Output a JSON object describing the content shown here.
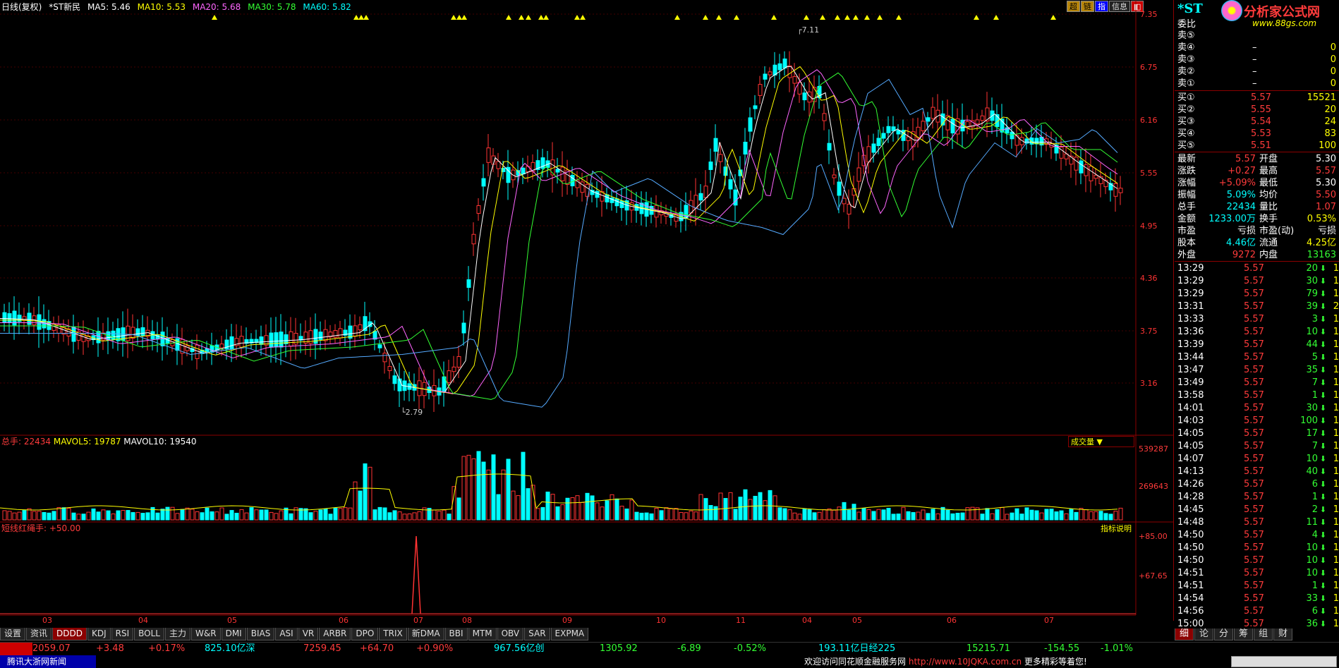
{
  "header": {
    "period": "日线(复权)",
    "stock": "*ST新民",
    "ma5": "MA5: 5.46",
    "ma10": "MA10: 5.53",
    "ma20": "MA20: 5.68",
    "ma30": "MA30: 5.78",
    "ma60": "MA60: 5.82"
  },
  "top_buttons": [
    "超",
    "链",
    "指",
    "信息"
  ],
  "price_ticks": [
    "7.35",
    "6.75",
    "6.16",
    "5.55",
    "4.95",
    "4.36",
    "3.75",
    "3.16"
  ],
  "annot_high": "7.11",
  "annot_low": "2.79",
  "vol_header": {
    "total": "总手: 22434",
    "mavol5": "MAVOL5: 19787",
    "mavol10": "MAVOL10: 19540"
  },
  "vol_ticks": [
    "539287",
    "269643"
  ],
  "vol_select": "成交量 ▼",
  "ind_header": "短线红绳手: +50.00",
  "ind_btn": "指标说明",
  "ind_ticks": [
    "+85.00",
    "+67.65"
  ],
  "x_axis": [
    "03",
    "04",
    "05",
    "06",
    "07",
    "08",
    "09",
    "10",
    "11",
    "04",
    "05",
    "06",
    "07"
  ],
  "tabs": [
    "设置",
    "资讯",
    "DDDD",
    "KDJ",
    "RSI",
    "BOLL",
    "主力",
    "W&R",
    "DMI",
    "BIAS",
    "ASI",
    "VR",
    "ARBR",
    "DPO",
    "TRIX",
    "新DMA",
    "BBI",
    "MTM",
    "OBV",
    "SAR",
    "EXPMA"
  ],
  "status": {
    "sh_idx": "2059.07",
    "sh_chg": "+3.48",
    "sh_pct": "+0.17%",
    "sh_amt": "825.10亿深",
    "sz_idx": "7259.45",
    "sz_chg": "+64.70",
    "sz_pct": "+0.90%",
    "sz_amt": "967.56亿创",
    "cy_idx": "1305.92",
    "cy_chg": "-6.89",
    "cy_pct": "-0.52%",
    "cy_amt": "193.11亿日经225",
    "nk_idx": "15215.71",
    "nk_chg": "-154.55",
    "nk_pct": "-1.01%"
  },
  "bottom": {
    "news": "腾讯大浙网新闻",
    "welcome": "欢迎访问同花顺金融服务网",
    "url": "http://www.10JQKA.com.cn",
    "more": "更多精彩等着您!"
  },
  "logo": {
    "name": "分析家公式网",
    "url": "www.88gs.com"
  },
  "right": {
    "code": "*ST",
    "weibi": "委比",
    "sells": [
      {
        "l": "卖⑤",
        "p": "",
        "v": ""
      },
      {
        "l": "卖④",
        "p": "–",
        "v": "0"
      },
      {
        "l": "卖③",
        "p": "–",
        "v": "0"
      },
      {
        "l": "卖②",
        "p": "–",
        "v": "0"
      },
      {
        "l": "卖①",
        "p": "–",
        "v": "0"
      }
    ],
    "buys": [
      {
        "l": "买①",
        "p": "5.57",
        "v": "15521"
      },
      {
        "l": "买②",
        "p": "5.55",
        "v": "20"
      },
      {
        "l": "买③",
        "p": "5.54",
        "v": "24"
      },
      {
        "l": "买④",
        "p": "5.53",
        "v": "83"
      },
      {
        "l": "买⑤",
        "p": "5.51",
        "v": "100"
      }
    ],
    "stats": [
      {
        "a": "最新",
        "av": "5.57",
        "b": "开盘",
        "bv": "5.30"
      },
      {
        "a": "涨跌",
        "av": "+0.27",
        "b": "最高",
        "bv": "5.57"
      },
      {
        "a": "涨幅",
        "av": "+5.09%",
        "b": "最低",
        "bv": "5.30"
      },
      {
        "a": "振幅",
        "av": "5.09%",
        "b": "均价",
        "bv": "5.50"
      },
      {
        "a": "总手",
        "av": "22434",
        "b": "量比",
        "bv": "1.07"
      },
      {
        "a": "金额",
        "av": "1233.00万",
        "b": "换手",
        "bv": "0.53%"
      },
      {
        "a": "市盈",
        "av": "亏损",
        "b": "市盈(动)",
        "bv": "亏损"
      },
      {
        "a": "股本",
        "av": "4.46亿",
        "b": "流通",
        "bv": "4.25亿"
      },
      {
        "a": "外盘",
        "av": "9272",
        "b": "内盘",
        "bv": "13163"
      }
    ],
    "ticks": [
      [
        "13:29",
        "5.57",
        "20",
        "1"
      ],
      [
        "13:29",
        "5.57",
        "30",
        "1"
      ],
      [
        "13:29",
        "5.57",
        "79",
        "1"
      ],
      [
        "13:31",
        "5.57",
        "39",
        "2"
      ],
      [
        "13:33",
        "5.57",
        "3",
        "1"
      ],
      [
        "13:36",
        "5.57",
        "10",
        "1"
      ],
      [
        "13:39",
        "5.57",
        "44",
        "1"
      ],
      [
        "13:44",
        "5.57",
        "5",
        "1"
      ],
      [
        "13:47",
        "5.57",
        "35",
        "1"
      ],
      [
        "13:49",
        "5.57",
        "7",
        "1"
      ],
      [
        "13:58",
        "5.57",
        "1",
        "1"
      ],
      [
        "14:01",
        "5.57",
        "30",
        "1"
      ],
      [
        "14:03",
        "5.57",
        "100",
        "1"
      ],
      [
        "14:05",
        "5.57",
        "17",
        "1"
      ],
      [
        "14:05",
        "5.57",
        "7",
        "1"
      ],
      [
        "14:07",
        "5.57",
        "10",
        "1"
      ],
      [
        "14:13",
        "5.57",
        "40",
        "1"
      ],
      [
        "14:26",
        "5.57",
        "6",
        "1"
      ],
      [
        "14:28",
        "5.57",
        "1",
        "1"
      ],
      [
        "14:45",
        "5.57",
        "2",
        "1"
      ],
      [
        "14:48",
        "5.57",
        "11",
        "1"
      ],
      [
        "14:50",
        "5.57",
        "4",
        "1"
      ],
      [
        "14:50",
        "5.57",
        "10",
        "1"
      ],
      [
        "14:50",
        "5.57",
        "10",
        "1"
      ],
      [
        "14:51",
        "5.57",
        "10",
        "1"
      ],
      [
        "14:51",
        "5.57",
        "1",
        "1"
      ],
      [
        "14:54",
        "5.57",
        "33",
        "1"
      ],
      [
        "14:56",
        "5.57",
        "6",
        "1"
      ],
      [
        "15:00",
        "5.57",
        "36",
        "1"
      ]
    ],
    "bottom_tabs": [
      "细",
      "论",
      "分",
      "筹",
      "组",
      "财"
    ]
  }
}
